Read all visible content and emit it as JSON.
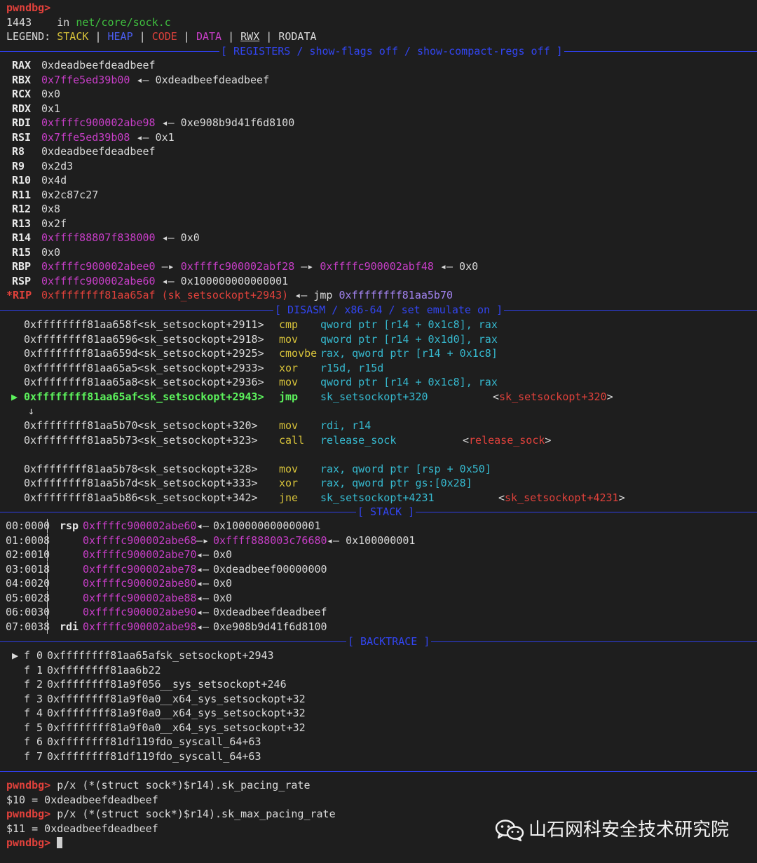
{
  "header": {
    "prompt": "pwndbg>",
    "line_no": "1443",
    "in_text": "in",
    "file": "net/core/sock.c",
    "legend_label": "LEGEND:",
    "legend": {
      "stack": "STACK",
      "heap": "HEAP",
      "code": "CODE",
      "data": "DATA",
      "rwx": "RWX",
      "rodata": "RODATA",
      "sep": "|"
    }
  },
  "banners": {
    "registers": "[ REGISTERS / show-flags off / show-compact-regs off ]",
    "disasm": "[ DISASM / x86-64 / set emulate on ]",
    "stack": "[ STACK ]",
    "backtrace": "[ BACKTRACE ]"
  },
  "registers": [
    {
      "name": "RAX",
      "value": "0xdeadbeefdeadbeef",
      "ptr": false,
      "deref": ""
    },
    {
      "name": "RBX",
      "value": "0x7ffe5ed39b00",
      "ptr": true,
      "deref": "◂— 0xdeadbeefdeadbeef"
    },
    {
      "name": "RCX",
      "value": "0x0",
      "ptr": false,
      "deref": ""
    },
    {
      "name": "RDX",
      "value": "0x1",
      "ptr": false,
      "deref": ""
    },
    {
      "name": "RDI",
      "value": "0xffffc900002abe98",
      "ptr": true,
      "deref": "◂— 0xe908b9d41f6d8100"
    },
    {
      "name": "RSI",
      "value": "0x7ffe5ed39b08",
      "ptr": true,
      "deref": "◂— 0x1"
    },
    {
      "name": "R8",
      "value": "0xdeadbeefdeadbeef",
      "ptr": false,
      "deref": ""
    },
    {
      "name": "R9",
      "value": "0x2d3",
      "ptr": false,
      "deref": ""
    },
    {
      "name": "R10",
      "value": "0x4d",
      "ptr": false,
      "deref": ""
    },
    {
      "name": "R11",
      "value": "0x2c87c27",
      "ptr": false,
      "deref": ""
    },
    {
      "name": "R12",
      "value": "0x8",
      "ptr": false,
      "deref": ""
    },
    {
      "name": "R13",
      "value": "0x2f",
      "ptr": false,
      "deref": ""
    },
    {
      "name": "R14",
      "value": "0xffff88807f838000",
      "ptr": true,
      "deref": "◂— 0x0"
    },
    {
      "name": "R15",
      "value": "0x0",
      "ptr": false,
      "deref": ""
    }
  ],
  "rbp": {
    "name": "RBP",
    "v1": "0xffffc900002abee0",
    "arrow1": "—▸",
    "v2": "0xffffc900002abf28",
    "arrow2": "—▸",
    "v3": "0xffffc900002abf48",
    "deref": "◂— 0x0"
  },
  "rsp": {
    "name": "RSP",
    "value": "0xffffc900002abe60",
    "deref": "◂— 0x100000000000001"
  },
  "rip": {
    "name": "*RIP",
    "value": "0xffffffff81aa65af (sk_setsockopt+2943)",
    "deref": "◂— jmp",
    "target": "0xffffffff81aa5b70"
  },
  "disasm": [
    {
      "addr": "0xffffffff81aa658f",
      "sym": "<sk_setsockopt+2911>",
      "mn": "cmp",
      "ops": "qword ptr [r14 + 0x1c8], rax"
    },
    {
      "addr": "0xffffffff81aa6596",
      "sym": "<sk_setsockopt+2918>",
      "mn": "mov",
      "ops": "qword ptr [r14 + 0x1d0], rax"
    },
    {
      "addr": "0xffffffff81aa659d",
      "sym": "<sk_setsockopt+2925>",
      "mn": "cmovbe",
      "ops": "rax, qword ptr [r14 + 0x1c8]"
    },
    {
      "addr": "0xffffffff81aa65a5",
      "sym": "<sk_setsockopt+2933>",
      "mn": "xor",
      "ops": "r15d, r15d"
    },
    {
      "addr": "0xffffffff81aa65a8",
      "sym": "<sk_setsockopt+2936>",
      "mn": "mov",
      "ops": "qword ptr [r14 + 0x1c8], rax"
    }
  ],
  "disasm_current": {
    "marker": "▶",
    "addr": "0xffffffff81aa65af",
    "sym": "<sk_setsockopt+2943>",
    "mn": "jmp",
    "ops": "sk_setsockopt+320",
    "target": "sk_setsockopt+320"
  },
  "down_arrow": "↓",
  "disasm_after": [
    {
      "addr": "0xffffffff81aa5b70",
      "sym": "<sk_setsockopt+320>",
      "mn": "mov",
      "ops": "rdi, r14",
      "target": ""
    },
    {
      "addr": "0xffffffff81aa5b73",
      "sym": "<sk_setsockopt+323>",
      "mn": "call",
      "ops": "release_sock",
      "target": "release_sock"
    },
    {
      "addr": "0xffffffff81aa5b78",
      "sym": "<sk_setsockopt+328>",
      "mn": "mov",
      "ops": "rax, qword ptr [rsp + 0x50]",
      "target": ""
    },
    {
      "addr": "0xffffffff81aa5b7d",
      "sym": "<sk_setsockopt+333>",
      "mn": "xor",
      "ops": "rax, qword ptr gs:[0x28]",
      "target": ""
    },
    {
      "addr": "0xffffffff81aa5b86",
      "sym": "<sk_setsockopt+342>",
      "mn": "jne",
      "ops": "sk_setsockopt+4231",
      "target": "sk_setsockopt+4231"
    }
  ],
  "stack": [
    {
      "idx": "00:0000",
      "reg": "rsp",
      "addr": "0xffffc900002abe60",
      "arrow": "◂—",
      "val": "0x100000000000001",
      "ptrval": ""
    },
    {
      "idx": "01:0008",
      "reg": "",
      "addr": "0xffffc900002abe68",
      "arrow": "—▸",
      "val": "◂— 0x100000001",
      "ptrval": "0xffff888003c76680"
    },
    {
      "idx": "02:0010",
      "reg": "",
      "addr": "0xffffc900002abe70",
      "arrow": "◂—",
      "val": "0x0",
      "ptrval": ""
    },
    {
      "idx": "03:0018",
      "reg": "",
      "addr": "0xffffc900002abe78",
      "arrow": "◂—",
      "val": "0xdeadbeef00000000",
      "ptrval": ""
    },
    {
      "idx": "04:0020",
      "reg": "",
      "addr": "0xffffc900002abe80",
      "arrow": "◂—",
      "val": "0x0",
      "ptrval": ""
    },
    {
      "idx": "05:0028",
      "reg": "",
      "addr": "0xffffc900002abe88",
      "arrow": "◂—",
      "val": "0x0",
      "ptrval": ""
    },
    {
      "idx": "06:0030",
      "reg": "",
      "addr": "0xffffc900002abe90",
      "arrow": "◂—",
      "val": "0xdeadbeefdeadbeef",
      "ptrval": ""
    },
    {
      "idx": "07:0038",
      "reg": "rdi",
      "addr": "0xffffc900002abe98",
      "arrow": "◂—",
      "val": "0xe908b9d41f6d8100",
      "ptrval": ""
    }
  ],
  "backtrace": [
    {
      "marker": "▶",
      "frame": "f 0",
      "addr": "0xffffffff81aa65af",
      "sym": "sk_setsockopt+2943"
    },
    {
      "marker": "",
      "frame": "f 1",
      "addr": "0xffffffff81aa6b22",
      "sym": ""
    },
    {
      "marker": "",
      "frame": "f 2",
      "addr": "0xffffffff81a9f056",
      "sym": "__sys_setsockopt+246"
    },
    {
      "marker": "",
      "frame": "f 3",
      "addr": "0xffffffff81a9f0a0",
      "sym": "__x64_sys_setsockopt+32"
    },
    {
      "marker": "",
      "frame": "f 4",
      "addr": "0xffffffff81a9f0a0",
      "sym": "__x64_sys_setsockopt+32"
    },
    {
      "marker": "",
      "frame": "f 5",
      "addr": "0xffffffff81a9f0a0",
      "sym": "__x64_sys_setsockopt+32"
    },
    {
      "marker": "",
      "frame": "f 6",
      "addr": "0xffffffff81df119f",
      "sym": "do_syscall_64+63"
    },
    {
      "marker": "",
      "frame": "f 7",
      "addr": "0xffffffff81df119f",
      "sym": "do_syscall_64+63"
    }
  ],
  "console": [
    {
      "prompt": "pwndbg>",
      "text": " p/x (*(struct sock*)$r14).sk_pacing_rate"
    },
    {
      "prompt": "",
      "text": "$10 = 0xdeadbeefdeadbeef"
    },
    {
      "prompt": "pwndbg>",
      "text": " p/x (*(struct sock*)$r14).sk_max_pacing_rate"
    },
    {
      "prompt": "",
      "text": "$11 = 0xdeadbeefdeadbeef"
    }
  ],
  "final_prompt": "pwndbg>",
  "watermark": {
    "icon": "wechat-icon",
    "text": "山石网科安全技术研究院"
  },
  "colors": {
    "background": "#1e1e1e",
    "banner": "#3245f0",
    "pointer": "#c73ec7",
    "code": "#e0413b",
    "current": "#5cf25c",
    "mnemonic": "#d7c23a",
    "operand": "#36b9cf"
  }
}
